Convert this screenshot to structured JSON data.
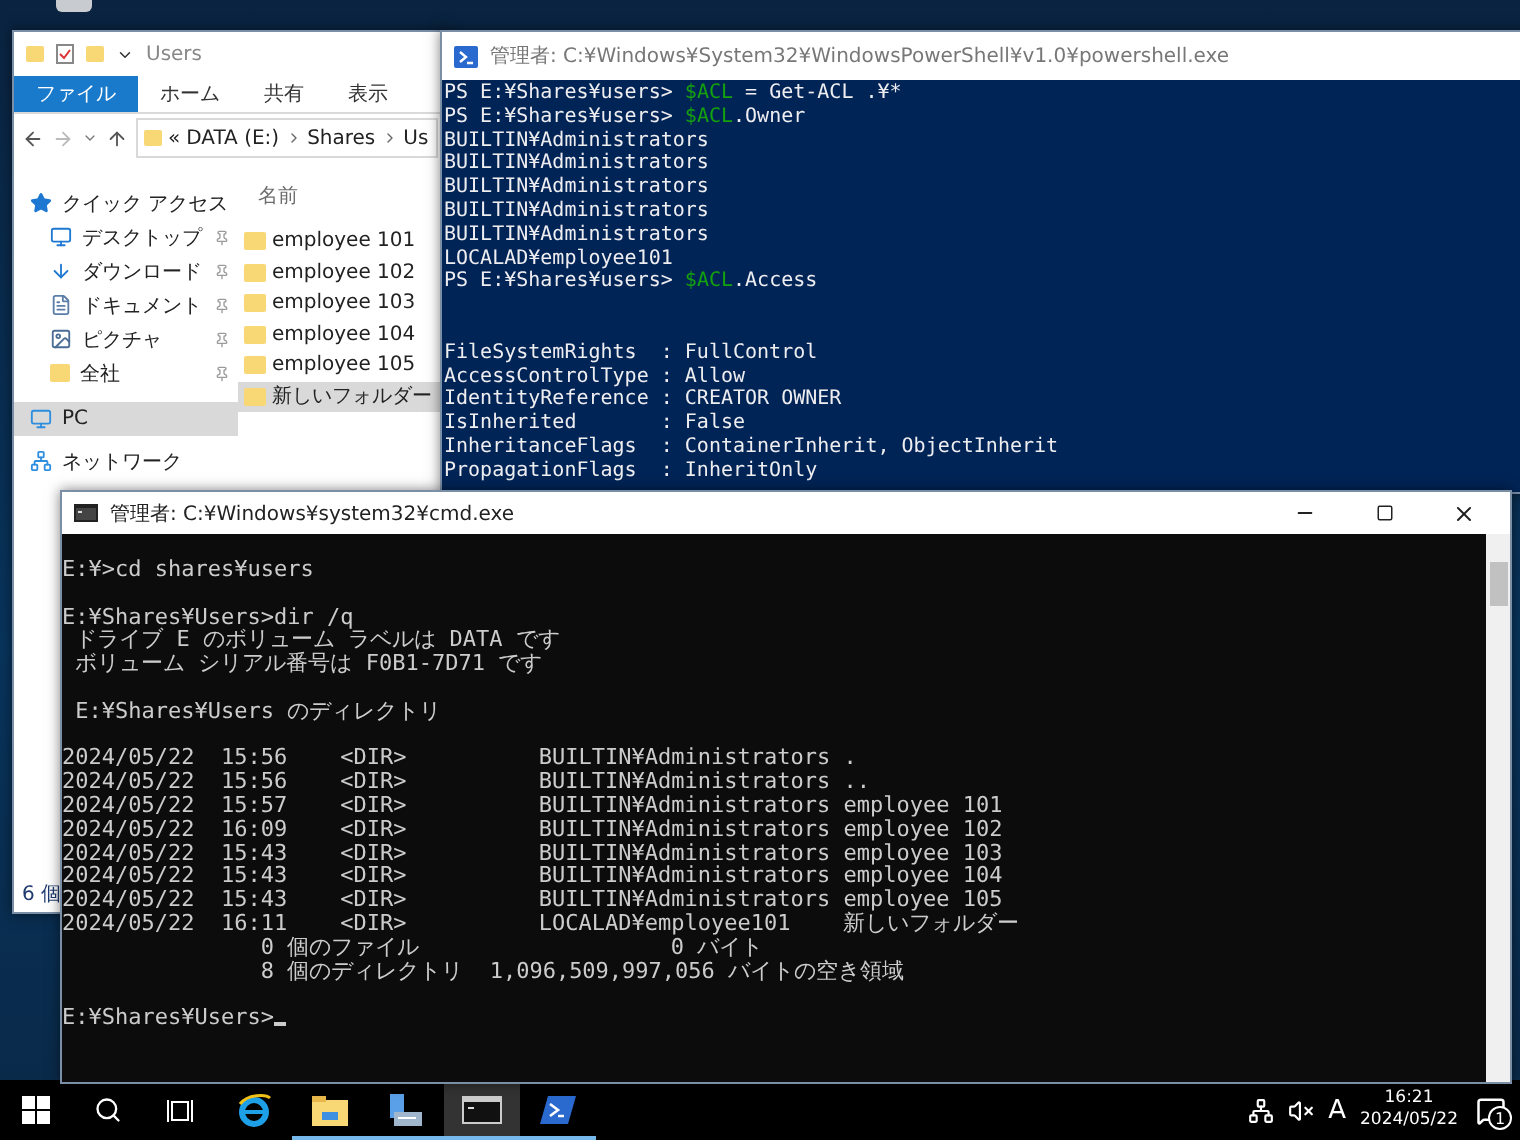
{
  "explorer": {
    "title": "Users",
    "ribbon_tabs": [
      {
        "label": "ファイル",
        "selected": true
      },
      {
        "label": "ホーム",
        "selected": false
      },
      {
        "label": "共有",
        "selected": false
      },
      {
        "label": "表示",
        "selected": false
      }
    ],
    "address": {
      "overflow": "«",
      "parts": [
        "DATA (E:)",
        "Shares",
        "Us"
      ]
    },
    "nav": [
      {
        "label": "クイック アクセス",
        "kind": "quick",
        "selected": false,
        "children": [
          {
            "label": "デスクトップ",
            "kind": "desktop",
            "pinned": true,
            "selected": false
          },
          {
            "label": "ダウンロード",
            "kind": "download",
            "pinned": true,
            "selected": false
          },
          {
            "label": "ドキュメント",
            "kind": "document",
            "pinned": true,
            "selected": false
          },
          {
            "label": "ピクチャ",
            "kind": "picture",
            "pinned": true,
            "selected": false
          },
          {
            "label": "全社",
            "kind": "folder",
            "pinned": true,
            "selected": false
          }
        ]
      },
      {
        "label": "PC",
        "kind": "pc",
        "selected": true
      },
      {
        "label": "ネットワーク",
        "kind": "network",
        "selected": false
      }
    ],
    "column_header": "名前",
    "files": [
      {
        "name": "employee 101",
        "selected": false
      },
      {
        "name": "employee 102",
        "selected": false
      },
      {
        "name": "employee 103",
        "selected": false
      },
      {
        "name": "employee 104",
        "selected": false
      },
      {
        "name": "employee 105",
        "selected": false
      },
      {
        "name": "新しいフォルダー",
        "selected": true
      }
    ],
    "status": "6 個"
  },
  "powershell": {
    "title": "管理者: C:¥Windows¥System32¥WindowsPowerShell¥v1.0¥powershell.exe",
    "blocks": [
      [
        [
          {
            "text": "PS E:¥Shares¥users> ",
            "kind": "prompt"
          },
          {
            "text": "$ACL",
            "kind": "variable"
          },
          {
            "text": " = Get-ACL .¥*",
            "kind": "command"
          }
        ],
        [
          {
            "text": "PS E:¥Shares¥users> ",
            "kind": "prompt"
          },
          {
            "text": "$ACL",
            "kind": "variable"
          },
          {
            "text": ".Owner",
            "kind": "command"
          }
        ],
        [
          {
            "text": "BUILTIN¥Administrators",
            "kind": "output"
          }
        ],
        [
          {
            "text": "BUILTIN¥Administrators",
            "kind": "output"
          }
        ],
        [
          {
            "text": "BUILTIN¥Administrators",
            "kind": "output"
          }
        ],
        [
          {
            "text": "BUILTIN¥Administrators",
            "kind": "output"
          }
        ],
        [
          {
            "text": "BUILTIN¥Administrators",
            "kind": "output"
          }
        ],
        [
          {
            "text": "LOCALAD¥employee101",
            "kind": "output"
          }
        ],
        [
          {
            "text": "PS E:¥Shares¥users> ",
            "kind": "prompt"
          },
          {
            "text": "$ACL",
            "kind": "variable"
          },
          {
            "text": ".Access",
            "kind": "command"
          }
        ]
      ],
      [
        [
          {
            "text": "FileSystemRights  : FullControl",
            "kind": "output"
          }
        ],
        [
          {
            "text": "AccessControlType : Allow",
            "kind": "output"
          }
        ],
        [
          {
            "text": "IdentityReference : CREATOR OWNER",
            "kind": "output"
          }
        ],
        [
          {
            "text": "IsInherited       : False",
            "kind": "output"
          }
        ],
        [
          {
            "text": "InheritanceFlags  : ContainerInherit, ObjectInherit",
            "kind": "output"
          }
        ],
        [
          {
            "text": "PropagationFlags  : InheritOnly",
            "kind": "output"
          }
        ]
      ]
    ]
  },
  "cmd": {
    "title": "管理者: C:¥Windows¥system32¥cmd.exe",
    "blocks": [
      [
        "E:¥>cd shares¥users"
      ],
      [
        "E:¥Shares¥Users>dir /q",
        " ドライブ E のボリューム ラベルは DATA です",
        " ボリューム シリアル番号は F0B1-7D71 です"
      ],
      [
        " E:¥Shares¥Users のディレクトリ"
      ],
      [
        "2024/05/22  15:56    <DIR>          BUILTIN¥Administrators .",
        "2024/05/22  15:56    <DIR>          BUILTIN¥Administrators ..",
        "2024/05/22  15:57    <DIR>          BUILTIN¥Administrators employee 101",
        "2024/05/22  16:09    <DIR>          BUILTIN¥Administrators employee 102",
        "2024/05/22  15:43    <DIR>          BUILTIN¥Administrators employee 103",
        "2024/05/22  15:43    <DIR>          BUILTIN¥Administrators employee 104",
        "2024/05/22  15:43    <DIR>          BUILTIN¥Administrators employee 105",
        "2024/05/22  16:11    <DIR>          LOCALAD¥employee101    新しいフォルダー",
        "               0 個のファイル                   0 バイト",
        "               8 個のディレクトリ  1,096,509,997,056 バイトの空き領域"
      ],
      [
        "E:¥Shares¥Users>"
      ]
    ],
    "cursor": true
  },
  "taskbar": {
    "apps": [
      {
        "kind": "start",
        "open": false,
        "active": false
      },
      {
        "kind": "search",
        "open": false,
        "active": false
      },
      {
        "kind": "taskview",
        "open": false,
        "active": false
      },
      {
        "kind": "browser",
        "open": false,
        "active": false
      },
      {
        "kind": "explorer",
        "open": true,
        "active": false
      },
      {
        "kind": "server",
        "open": true,
        "active": false
      },
      {
        "kind": "cmd",
        "open": true,
        "active": true
      },
      {
        "kind": "powershell",
        "open": true,
        "active": false
      }
    ],
    "ime": "A",
    "time": "16:21",
    "date": "2024/05/22",
    "notifications": "1"
  }
}
